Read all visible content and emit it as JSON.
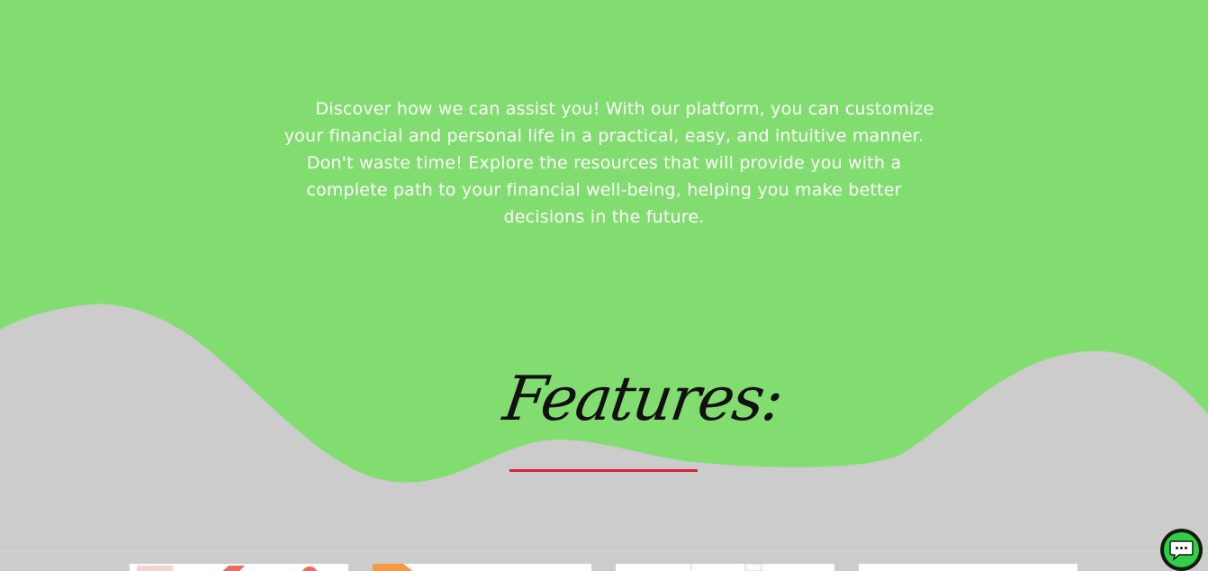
{
  "hero": {
    "intro_text": "Discover how we can assist you! With our platform, you can customize your financial and personal life in a practical, easy, and intuitive manner. Don't waste time! Explore the resources that will provide you with a complete path to your financial well-being, helping you make better decisions in the future."
  },
  "features": {
    "title": "Features:"
  },
  "colors": {
    "hero_green": "#82dd70",
    "section_gray": "#cccccc",
    "underline_red": "#d9223a",
    "chat_green": "#2fcf46"
  },
  "chat_widget": {
    "icon": "chat-bubble-icon"
  }
}
